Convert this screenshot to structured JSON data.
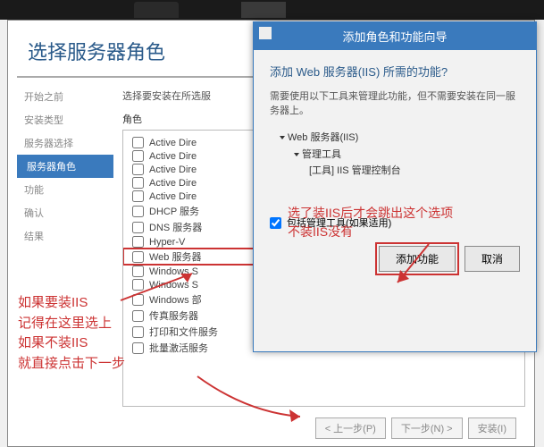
{
  "main": {
    "title": "选择服务器角色",
    "roles_header": "选择要安装在所选服",
    "roles_label": "角色",
    "sidebar": [
      "开始之前",
      "安装类型",
      "服务器选择",
      "服务器角色",
      "功能",
      "确认",
      "结果"
    ],
    "roles": [
      "Active Dire",
      "Active Dire",
      "Active Dire",
      "Active Dire",
      "Active Dire",
      "DHCP 服务",
      "DNS 服务器",
      "Hyper-V",
      "Web 服务器",
      "Windows S",
      "Windows S",
      "Windows 部",
      "传真服务器",
      "打印和文件服务",
      "批量激活服务"
    ],
    "btn_prev": "< 上一步(P)",
    "btn_next": "下一步(N) >",
    "btn_install": "安装(I)"
  },
  "dialog": {
    "title": "添加角色和功能向导",
    "question": "添加 Web 服务器(IIS) 所需的功能?",
    "hint": "需要使用以下工具来管理此功能，但不需要安装在同一服务器上。",
    "tree_lvl1": "Web 服务器(IIS)",
    "tree_lvl2": "管理工具",
    "tree_lvl3": "[工具] IIS 管理控制台",
    "include_label": "包括管理工具(如果适用)",
    "btn_add": "添加功能",
    "btn_cancel": "取消"
  },
  "anno": {
    "left": "如果要装IIS\n记得在这里选上\n如果不装IIS\n就直接点击下一步",
    "right": "选了装IIS后才会跳出这个选项\n不装IIS没有"
  }
}
